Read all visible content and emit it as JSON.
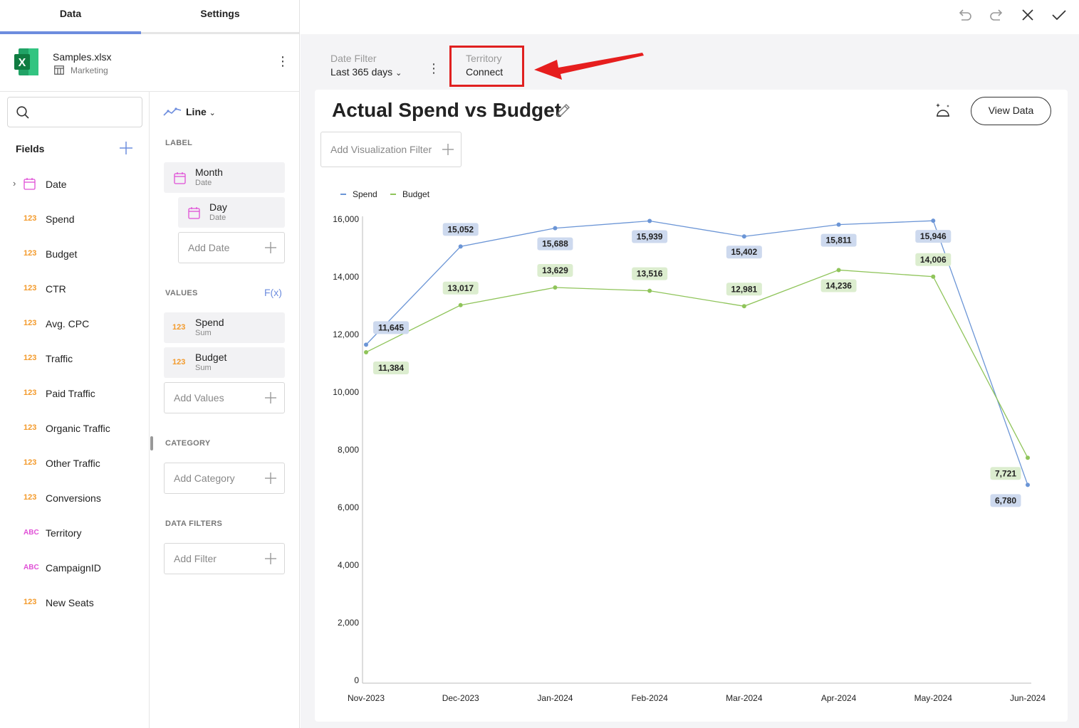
{
  "tabs": {
    "data": "Data",
    "settings": "Settings"
  },
  "source": {
    "file_name": "Samples.xlsx",
    "sheet_name": "Marketing",
    "icon_letter": "X"
  },
  "fields": {
    "title": "Fields",
    "search_placeholder": "",
    "items": [
      {
        "type": "date",
        "type_label": "",
        "name": "Date"
      },
      {
        "type": "number",
        "type_label": "123",
        "name": "Spend"
      },
      {
        "type": "number",
        "type_label": "123",
        "name": "Budget"
      },
      {
        "type": "number",
        "type_label": "123",
        "name": "CTR"
      },
      {
        "type": "number",
        "type_label": "123",
        "name": "Avg. CPC"
      },
      {
        "type": "number",
        "type_label": "123",
        "name": "Traffic"
      },
      {
        "type": "number",
        "type_label": "123",
        "name": "Paid Traffic"
      },
      {
        "type": "number",
        "type_label": "123",
        "name": "Organic Traffic"
      },
      {
        "type": "number",
        "type_label": "123",
        "name": "Other Traffic"
      },
      {
        "type": "number",
        "type_label": "123",
        "name": "Conversions"
      },
      {
        "type": "text",
        "type_label": "ABC",
        "name": "Territory"
      },
      {
        "type": "text",
        "type_label": "ABC",
        "name": "CampaignID"
      },
      {
        "type": "number",
        "type_label": "123",
        "name": "New Seats"
      }
    ]
  },
  "config": {
    "viz_type": "Line",
    "label_section": "LABEL",
    "label_pills": [
      {
        "main": "Month",
        "sub": "Date"
      },
      {
        "main": "Day",
        "sub": "Date"
      }
    ],
    "add_date": "Add Date",
    "values_section": "VALUES",
    "fx_label": "F(x)",
    "value_pills": [
      {
        "type_label": "123",
        "main": "Spend",
        "sub": "Sum"
      },
      {
        "type_label": "123",
        "main": "Budget",
        "sub": "Sum"
      }
    ],
    "add_values": "Add Values",
    "category_section": "CATEGORY",
    "add_category": "Add Category",
    "data_filters_section": "DATA FILTERS",
    "add_filter": "Add Filter"
  },
  "dashboard_filters": {
    "date_filter": {
      "label": "Date Filter",
      "value": "Last 365 days"
    },
    "territory": {
      "label": "Territory",
      "value": "Connect"
    }
  },
  "visualization": {
    "title": "Actual Spend vs Budget",
    "view_data_label": "View Data",
    "add_viz_filter_label": "Add Visualization Filter"
  },
  "colors": {
    "accent": "#6d8dde",
    "spend": "#6b95d6",
    "budget": "#8fc45a",
    "spend_label_bg": "#cdd9ee",
    "budget_label_bg": "#dcedcf",
    "highlight": "#e02020",
    "number_type": "#f39a2b",
    "text_type": "#e04fd6",
    "date_type": "#e04fd6"
  },
  "chart_data": {
    "type": "line",
    "categories": [
      "Nov-2023",
      "Dec-2023",
      "Jan-2024",
      "Feb-2024",
      "Mar-2024",
      "Apr-2024",
      "May-2024",
      "Jun-2024"
    ],
    "series": [
      {
        "name": "Spend",
        "values": [
          11645,
          15052,
          15688,
          15939,
          15402,
          15811,
          15946,
          6780
        ],
        "labels": [
          "11,645",
          "15,052",
          "15,688",
          "15,939",
          "15,402",
          "15,811",
          "15,946",
          "6,780"
        ]
      },
      {
        "name": "Budget",
        "values": [
          11384,
          13017,
          13629,
          13516,
          12981,
          14236,
          14006,
          7721
        ],
        "labels": [
          "11,384",
          "13,017",
          "13,629",
          "13,516",
          "12,981",
          "14,236",
          "14,006",
          "7,721"
        ]
      }
    ],
    "ylim": [
      0,
      16000
    ],
    "yticks": [
      0,
      2000,
      4000,
      6000,
      8000,
      10000,
      12000,
      14000,
      16000
    ],
    "ytick_labels": [
      "0",
      "2,000",
      "4,000",
      "6,000",
      "8,000",
      "10,000",
      "12,000",
      "14,000",
      "16,000"
    ],
    "legend_position": "top-left",
    "grid": false
  }
}
